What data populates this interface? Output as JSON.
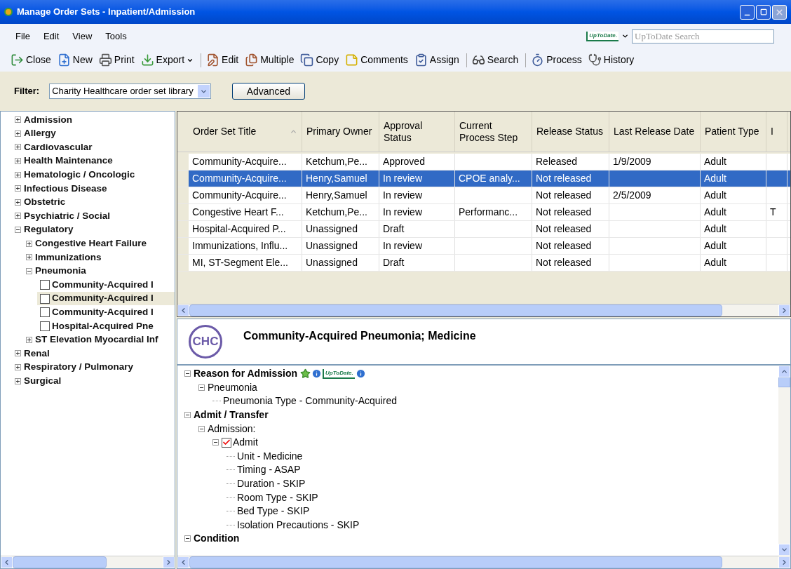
{
  "window": {
    "title": "Manage Order Sets - Inpatient/Admission"
  },
  "menu": [
    "File",
    "Edit",
    "View",
    "Tools"
  ],
  "uptodate": {
    "logo": "UpToDate.",
    "placeholder": "UpToDate Search"
  },
  "toolbar": [
    {
      "buttons": [
        {
          "label": "Close",
          "dropdown": false
        },
        {
          "label": "New",
          "dropdown": false
        },
        {
          "label": "Print",
          "dropdown": false
        },
        {
          "label": "Export",
          "dropdown": true
        }
      ]
    },
    {
      "buttons": [
        {
          "label": "Edit",
          "dropdown": false
        },
        {
          "label": "Multiple",
          "dropdown": false
        },
        {
          "label": "Copy",
          "dropdown": false
        },
        {
          "label": "Comments",
          "dropdown": false
        },
        {
          "label": "Assign",
          "dropdown": false
        }
      ]
    },
    {
      "buttons": [
        {
          "label": "Search",
          "dropdown": false
        }
      ]
    },
    {
      "buttons": [
        {
          "label": "Process",
          "dropdown": false
        },
        {
          "label": "History",
          "dropdown": false
        }
      ]
    }
  ],
  "filter": {
    "label": "Filter:",
    "value": "Charity Healthcare order set library",
    "button": "Advanced"
  },
  "sidebar": {
    "items": [
      {
        "label": "Admission",
        "expanded": false
      },
      {
        "label": "Allergy",
        "expanded": false
      },
      {
        "label": "Cardiovascular",
        "expanded": false
      },
      {
        "label": "Health Maintenance",
        "expanded": false
      },
      {
        "label": "Hematologic / Oncologic",
        "expanded": false
      },
      {
        "label": "Infectious Disease",
        "expanded": false
      },
      {
        "label": "Obstetric",
        "expanded": false
      },
      {
        "label": "Psychiatric / Social",
        "expanded": false
      },
      {
        "label": "Regulatory",
        "expanded": true,
        "children": [
          {
            "label": "Congestive Heart Failure",
            "expanded": false
          },
          {
            "label": "Immunizations",
            "expanded": false
          },
          {
            "label": "Pneumonia",
            "expanded": true,
            "children": [
              {
                "label": "Community-Acquired I",
                "kind": "checkbox",
                "checked": false,
                "selected": false
              },
              {
                "label": "Community-Acquired I",
                "kind": "checkbox",
                "checked": false,
                "selected": true
              },
              {
                "label": "Community-Acquired I",
                "kind": "checkbox",
                "checked": false,
                "selected": false
              },
              {
                "label": "Hospital-Acquired Pne",
                "kind": "checkbox",
                "checked": false,
                "selected": false
              }
            ]
          },
          {
            "label": "ST Elevation Myocardial Inf",
            "expanded": false
          }
        ]
      },
      {
        "label": "Renal",
        "expanded": false
      },
      {
        "label": "Respiratory / Pulmonary",
        "expanded": false
      },
      {
        "label": "Surgical",
        "expanded": false
      }
    ]
  },
  "table": {
    "columns": [
      {
        "label": "Order Set Title",
        "sorted": true
      },
      {
        "label": "Primary Owner",
        "sorted": false
      },
      {
        "label": "Approval Status",
        "sorted": false
      },
      {
        "label": "Current Process Step",
        "sorted": false
      },
      {
        "label": "Release Status",
        "sorted": false
      },
      {
        "label": "Last Release Date",
        "sorted": false
      },
      {
        "label": "Patient Type",
        "sorted": false
      },
      {
        "label": "I",
        "sorted": false
      }
    ],
    "rows": [
      {
        "selected": false,
        "cells": [
          "Community-Acquire...",
          "Ketchum,Pe...",
          "Approved",
          null,
          "Released",
          "1/9/2009",
          "Adult",
          null
        ]
      },
      {
        "selected": true,
        "cells": [
          "Community-Acquire...",
          "Henry,Samuel",
          "In review",
          "CPOE analy...",
          "Not released",
          null,
          "Adult",
          null
        ]
      },
      {
        "selected": false,
        "cells": [
          "Community-Acquire...",
          "Henry,Samuel",
          "In review",
          null,
          "Not released",
          "2/5/2009",
          "Adult",
          null
        ]
      },
      {
        "selected": false,
        "cells": [
          "Congestive Heart F...",
          "Ketchum,Pe...",
          "In review",
          "Performanc...",
          "Not released",
          null,
          "Adult",
          "T"
        ]
      },
      {
        "selected": false,
        "cells": [
          "Hospital-Acquired P...",
          "Unassigned",
          "Draft",
          null,
          "Not released",
          null,
          "Adult",
          null
        ]
      },
      {
        "selected": false,
        "cells": [
          "Immunizations, Influ...",
          "Unassigned",
          "In review",
          null,
          "Not released",
          null,
          "Adult",
          null
        ]
      },
      {
        "selected": false,
        "cells": [
          "MI, ST-Segment Ele...",
          "Unassigned",
          "Draft",
          null,
          "Not released",
          null,
          "Adult",
          null
        ]
      }
    ]
  },
  "detail": {
    "logo": "CHC",
    "title": "Community-Acquired Pneumonia; Medicine",
    "tree": [
      {
        "label": "Reason for Admission",
        "kind": "section",
        "expanded": true,
        "logo_text": "UpToDate.",
        "children": [
          {
            "label": "Pneumonia",
            "kind": "item",
            "expanded": true,
            "children": [
              {
                "label": "Pneumonia Type - Community-Acquired",
                "kind": "item"
              }
            ]
          }
        ]
      },
      {
        "label": "Admit / Transfer",
        "kind": "section",
        "expanded": true,
        "children": [
          {
            "label": "Admission:",
            "kind": "item",
            "expanded": true,
            "children": [
              {
                "label": "Admit",
                "kind": "checkbox",
                "checked": true,
                "expanded": true,
                "children": [
                  {
                    "label": "Unit - Medicine",
                    "kind": "item"
                  },
                  {
                    "label": "Timing - ASAP",
                    "kind": "item"
                  },
                  {
                    "label": "Duration - SKIP",
                    "kind": "item"
                  },
                  {
                    "label": "Room Type - SKIP",
                    "kind": "item"
                  },
                  {
                    "label": "Bed Type - SKIP",
                    "kind": "item"
                  },
                  {
                    "label": "Isolation Precautions - SKIP",
                    "kind": "item"
                  }
                ]
              }
            ]
          }
        ]
      },
      {
        "label": "Condition",
        "kind": "section",
        "expanded": true
      }
    ]
  }
}
